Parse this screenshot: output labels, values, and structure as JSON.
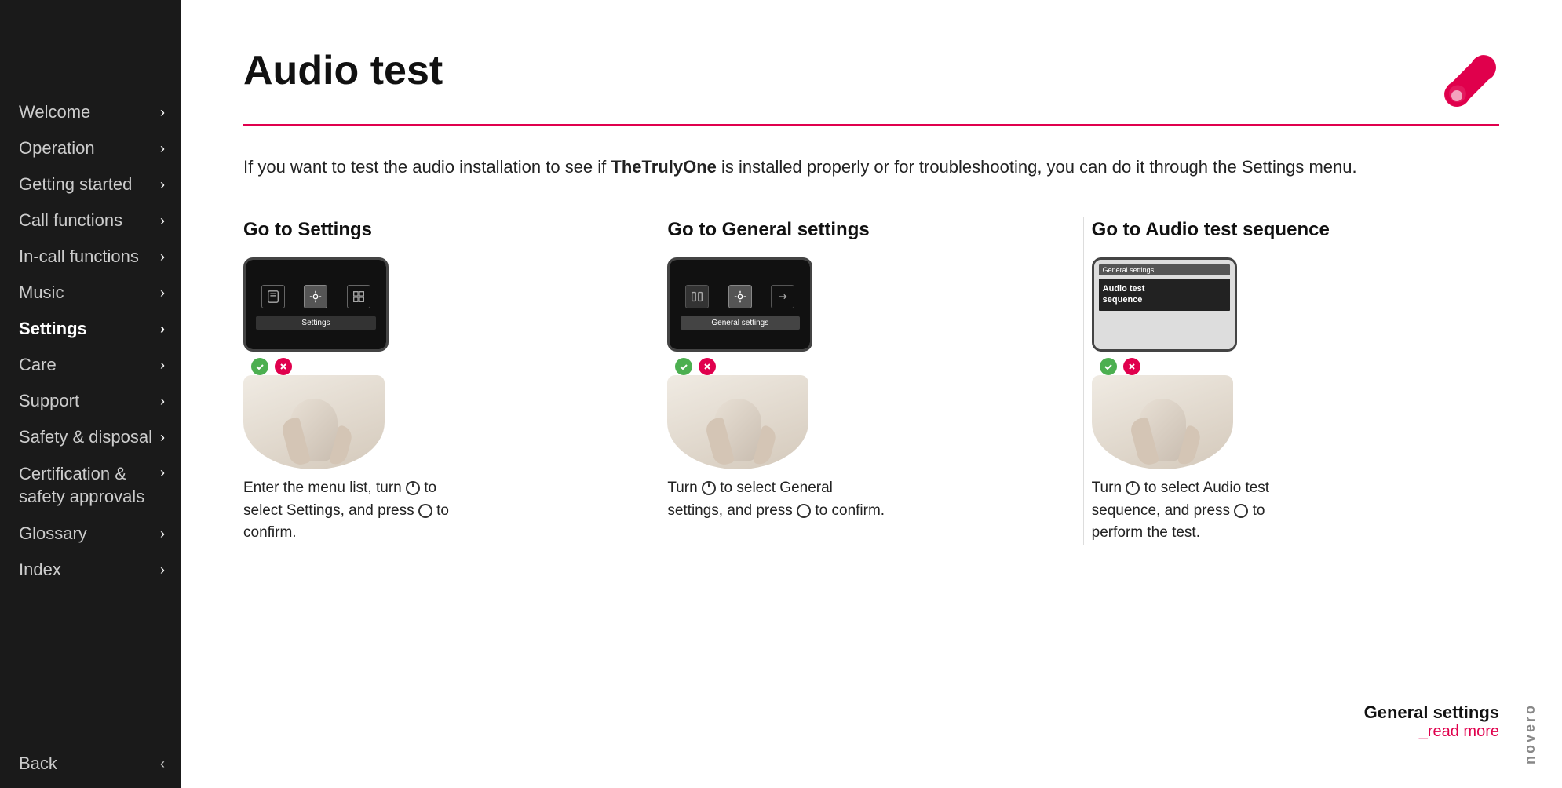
{
  "sidebar": {
    "items": [
      {
        "label": "Welcome",
        "active": false
      },
      {
        "label": "Operation",
        "active": false
      },
      {
        "label": "Getting started",
        "active": false
      },
      {
        "label": "Call functions",
        "active": false
      },
      {
        "label": "In-call functions",
        "active": false
      },
      {
        "label": "Music",
        "active": false
      },
      {
        "label": "Settings",
        "active": true
      },
      {
        "label": "Care",
        "active": false
      },
      {
        "label": "Support",
        "active": false
      },
      {
        "label": "Safety & disposal",
        "active": false
      },
      {
        "label": "Certification & safety approvals",
        "active": false
      },
      {
        "label": "Glossary",
        "active": false
      },
      {
        "label": "Index",
        "active": false
      }
    ],
    "back_label": "Back"
  },
  "page": {
    "title": "Audio test",
    "intro": "If you want to test the audio installation to see if ",
    "intro_bold": "TheTrulyOne",
    "intro_rest": " is installed properly or for troubleshooting, you can do it through the Settings menu."
  },
  "steps": [
    {
      "title": "Go to Settings",
      "screen_label": "Settings",
      "desc": "Enter the menu list, turn  to select Settings, and press  to confirm."
    },
    {
      "title": "Go to General settings",
      "screen_label": "General settings",
      "desc": "Turn  to select General settings, and press  to confirm."
    },
    {
      "title": "Go to Audio test sequence",
      "screen_label1": "General settings",
      "screen_label2": "Audio test sequence",
      "desc": "Turn  to select Audio test sequence, and press  to perform the test."
    }
  ],
  "bottom_panel": {
    "title": "General settings",
    "link": "_read more"
  },
  "brand": {
    "name": "novero",
    "accent_color": "#e0004d"
  }
}
